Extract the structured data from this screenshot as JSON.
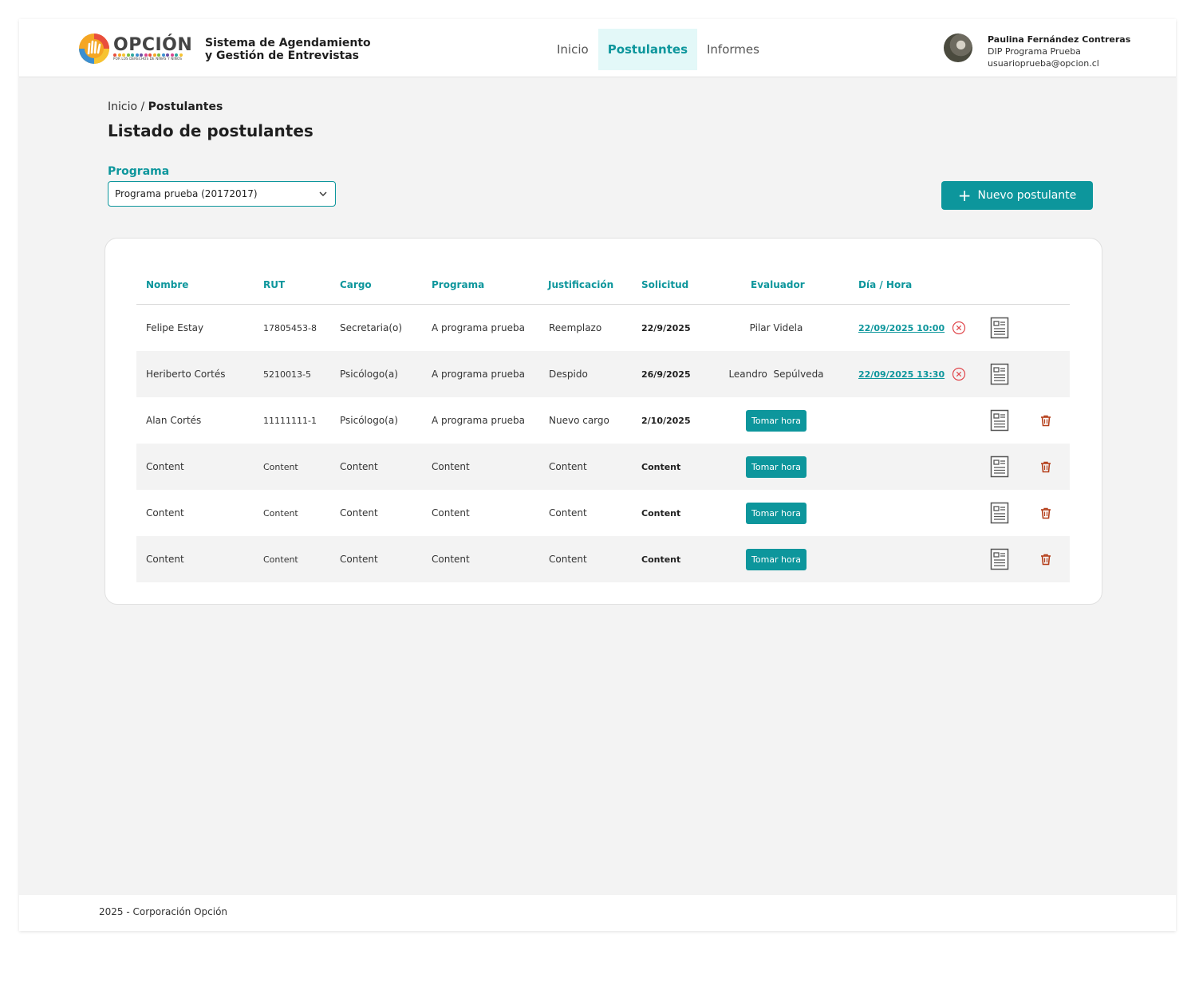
{
  "header": {
    "logo_text": "OPCIÓN",
    "logo_tagline": "POR LOS DERECHOS DE NIÑAS Y NIÑOS",
    "app_title_line1": "Sistema de Agendamiento",
    "app_title_line2": "y Gestión de Entrevistas",
    "nav": [
      {
        "label": "Inicio",
        "active": false
      },
      {
        "label": "Postulantes",
        "active": true
      },
      {
        "label": "Informes",
        "active": false
      }
    ],
    "user": {
      "name": "Paulina Fernández Contreras",
      "role": "DIP Programa Prueba",
      "email": "usuarioprueba@opcion.cl"
    }
  },
  "breadcrumb": {
    "root": "Inicio",
    "separator": " / ",
    "current": "Postulantes"
  },
  "page_title": "Listado de postulantes",
  "filter": {
    "label": "Programa",
    "selected": "Programa prueba (20172017)"
  },
  "new_button_label": "Nuevo postulante",
  "table": {
    "columns": [
      "Nombre",
      "RUT",
      "Cargo",
      "Programa",
      "Justificación",
      "Solicitud",
      "Evaluador",
      "Día / Hora"
    ],
    "take_hour_label": "Tomar hora",
    "rows": [
      {
        "nombre": "Felipe Estay",
        "rut": "17805453-8",
        "cargo": "Secretaria(o)",
        "programa": "A programa prueba",
        "justificacion": "Reemplazo",
        "solicitud": "22/9/2025",
        "evaluador": "Pilar Videla",
        "dia_hora": "22/09/2025 10:00",
        "deletable": false
      },
      {
        "nombre": "Heriberto Cortés",
        "rut": "5210013-5",
        "cargo": "Psicólogo(a)",
        "programa": "A programa prueba",
        "justificacion": "Despido",
        "solicitud": "26/9/2025",
        "evaluador": "Leandro  Sepúlveda",
        "dia_hora": "22/09/2025 13:30",
        "deletable": false
      },
      {
        "nombre": "Alan Cortés",
        "rut": "11111111-1",
        "cargo": "Psicólogo(a)",
        "programa": "A programa prueba",
        "justificacion": "Nuevo cargo",
        "solicitud": "2/10/2025",
        "evaluador": null,
        "dia_hora": null,
        "deletable": true
      },
      {
        "nombre": "Content",
        "rut": "Content",
        "cargo": "Content",
        "programa": "Content",
        "justificacion": "Content",
        "solicitud": "Content",
        "evaluador": null,
        "dia_hora": null,
        "deletable": true
      },
      {
        "nombre": "Content",
        "rut": "Content",
        "cargo": "Content",
        "programa": "Content",
        "justificacion": "Content",
        "solicitud": "Content",
        "evaluador": null,
        "dia_hora": null,
        "deletable": true
      },
      {
        "nombre": "Content",
        "rut": "Content",
        "cargo": "Content",
        "programa": "Content",
        "justificacion": "Content",
        "solicitud": "Content",
        "evaluador": null,
        "dia_hora": null,
        "deletable": true
      }
    ]
  },
  "footer": {
    "text": "2025 - Corporación Opción"
  },
  "colors": {
    "accent": "#0d969c",
    "nav_active_bg": "#e3f8f8",
    "cancel": "#e0474c",
    "trash": "#b5401c",
    "page_bg": "#f3f3f3"
  },
  "icons": {
    "logo": "hand-logo-icon",
    "select": "chevron-down-icon",
    "new": "plus-icon",
    "cancel": "cancel-circle-icon",
    "document": "document-icon",
    "delete": "trash-icon"
  }
}
